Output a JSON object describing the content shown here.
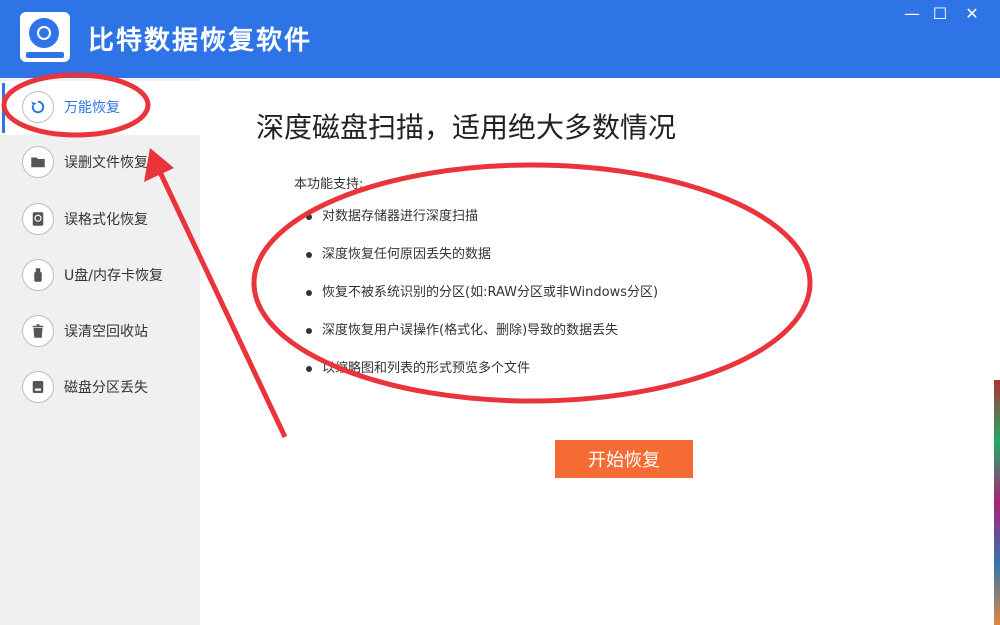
{
  "app": {
    "title": "比特数据恢复软件"
  },
  "window_controls": {
    "minimize": "—",
    "maximize": "☐",
    "close": "✕"
  },
  "sidebar": {
    "items": [
      {
        "label": "万能恢复",
        "icon": "undo-icon",
        "active": true
      },
      {
        "label": "误删文件恢复",
        "icon": "folder-icon",
        "active": false
      },
      {
        "label": "误格式化恢复",
        "icon": "disk-icon",
        "active": false
      },
      {
        "label": "U盘/内存卡恢复",
        "icon": "usb-icon",
        "active": false
      },
      {
        "label": "误清空回收站",
        "icon": "trash-icon",
        "active": false
      },
      {
        "label": "磁盘分区丢失",
        "icon": "drive-icon",
        "active": false
      }
    ]
  },
  "main": {
    "title": "深度磁盘扫描，适用绝大多数情况",
    "features_heading": "本功能支持:",
    "features": [
      "对数据存储器进行深度扫描",
      "深度恢复任何原因丢失的数据",
      "恢复不被系统识别的分区(如:RAW分区或非Windows分区)",
      "深度恢复用户误操作(格式化、删除)导致的数据丢失",
      "以缩略图和列表的形式预览多个文件"
    ],
    "start_button": "开始恢复"
  },
  "colors": {
    "accent": "#2e74e6",
    "button": "#f46b33",
    "annotation": "#e8343a"
  }
}
